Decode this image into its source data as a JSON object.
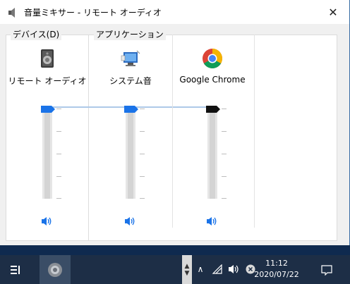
{
  "window": {
    "title": "音量ミキサー - リモート オーディオ",
    "close_glyph": "✕"
  },
  "groups": {
    "device_label": "デバイス(D)",
    "apps_label": "アプリケーション"
  },
  "channels": [
    {
      "name": "リモート オーディオ",
      "icon": "speaker-device-icon",
      "volume_percent": 100,
      "thumb_color": "#1a73e8"
    },
    {
      "name": "システム音",
      "icon": "system-sounds-icon",
      "volume_percent": 100,
      "thumb_color": "#1a73e8"
    },
    {
      "name": "Google Chrome",
      "icon": "chrome-icon",
      "volume_percent": 100,
      "thumb_color": "#111111"
    }
  ],
  "taskbar": {
    "time": "11:12",
    "date": "2020/07/22",
    "tray_up_glyph": "∧"
  },
  "colors": {
    "accent": "#1a73e8",
    "taskbar": "#1d2e46"
  }
}
